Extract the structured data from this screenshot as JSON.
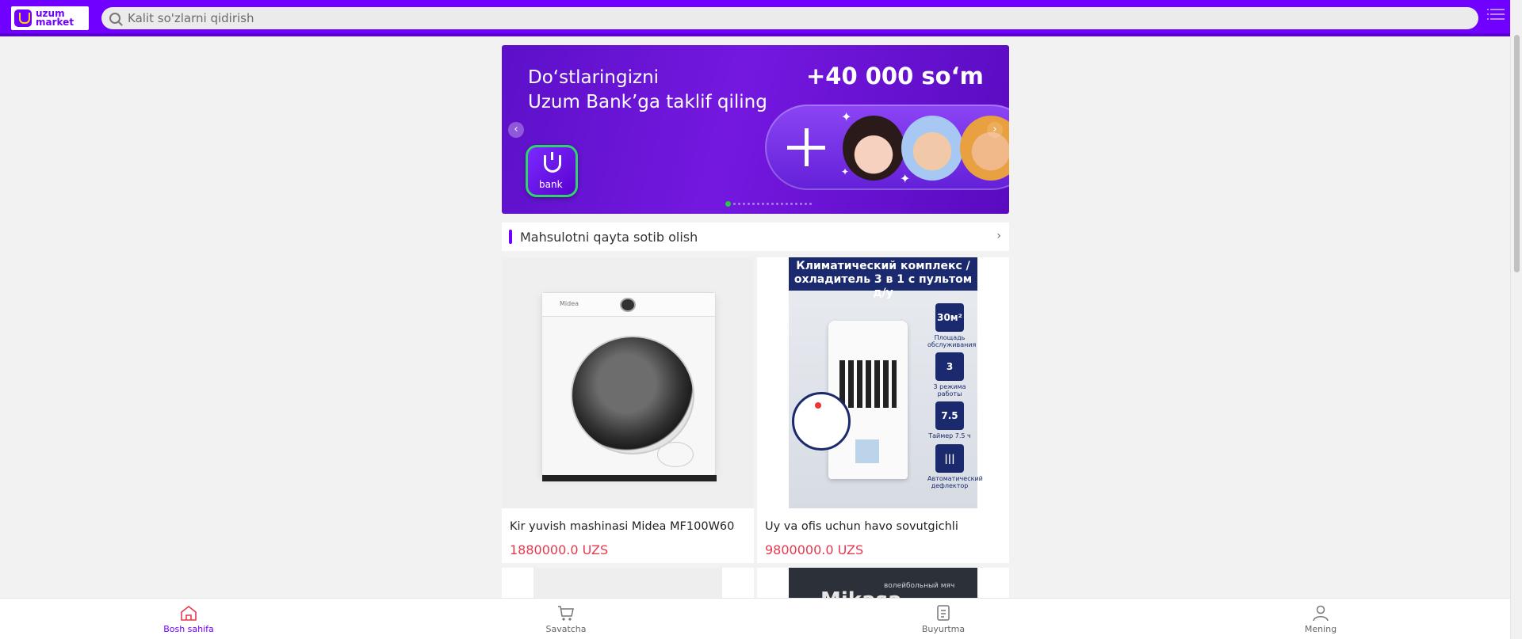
{
  "header": {
    "logo_text_line1": "uzum",
    "logo_text_line2": "market",
    "search_placeholder": "Kalit so'zlarni qidirish"
  },
  "banner": {
    "title_line1": "Do‘stlaringizni",
    "title_line2": "Uzum Bank’ga taklif qiling",
    "bonus": "+40 000 so‘m",
    "app_label": "bank",
    "active_slide": 1,
    "slide_count": 18
  },
  "section": {
    "title": "Mahsulotni qayta sotib olish"
  },
  "products": [
    {
      "name": "Kir yuvish mashinasi Midea MF100W60",
      "price": "1880000.0 UZS",
      "image_label": "Midea"
    },
    {
      "name": "Uy va ofis uchun havo sovutgichli",
      "price": "9800000.0 UZS",
      "poster_title": "Климатический комплекс / охладитель 3 в 1 с пультом д/у",
      "features": [
        {
          "value": "30м²",
          "label": "Площадь обслуживания"
        },
        {
          "value": "3",
          "label": "3 режима работы"
        },
        {
          "value": "7.5",
          "label": "Таймер 7.5 ч"
        },
        {
          "value": "|||",
          "label": "Автоматический дефлектор"
        }
      ]
    }
  ],
  "partial_products": [
    {
      "image_text": ""
    },
    {
      "image_text": "волейбольный мяч",
      "image_big_text": "Mikasa"
    }
  ],
  "bottom_nav": [
    {
      "label": "Bosh sahifa",
      "icon": "home-icon",
      "active": true
    },
    {
      "label": "Savatcha",
      "icon": "cart-icon",
      "active": false
    },
    {
      "label": "Buyurtma",
      "icon": "orders-icon",
      "active": false
    },
    {
      "label": "Mening",
      "icon": "user-icon",
      "active": false
    }
  ],
  "colors": {
    "brand": "#7000ff",
    "price": "#e8384f",
    "active_dot": "#26c944"
  }
}
